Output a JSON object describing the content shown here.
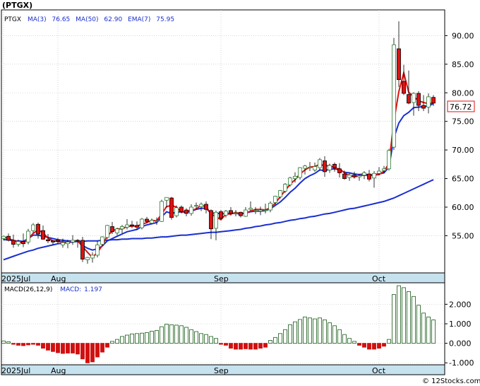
{
  "header": {
    "ticker": "(PTGX)",
    "legend_symbol": "PTGX",
    "ma3_label": "MA(3)",
    "ma3_value": "76.65",
    "ma50_label": "MA(50)",
    "ma50_value": "62.90",
    "ema7_label": "EMA(7)",
    "ema7_value": "75.95"
  },
  "price_box": "76.72",
  "macd_header": {
    "label": "MACD(26,12,9)",
    "value_label": "MACD:",
    "value": "1.197"
  },
  "watermark": "© 12Stocks.com",
  "colors": {
    "up": "#2e7d32",
    "down": "#e01010",
    "ma": "#1a2fd0",
    "ema": "#e01010",
    "axis_band": "#c6e2ef",
    "macd_up": "#2e6b2e",
    "macd_down": "#d01010"
  },
  "chart_data": [
    {
      "type": "candlestick",
      "title": "PTGX",
      "x_labels": [
        "2025Jul",
        "Aug",
        "Sep",
        "Oct"
      ],
      "x_label_index": [
        0,
        11,
        44,
        76
      ],
      "ylim": [
        48.5,
        94.5
      ],
      "yticks": [
        55.0,
        60.0,
        65.0,
        70.0,
        75.0,
        80.0,
        85.0,
        90.0
      ],
      "ytick_labels": [
        "55.00",
        "60.00",
        "65.00",
        "70.00",
        "75.00",
        "80.00",
        "85.00",
        "90.00"
      ],
      "grid": true,
      "ohlc": [
        [
          54.5,
          55.0,
          54.2,
          54.9
        ],
        [
          54.9,
          55.4,
          54.0,
          54.2
        ],
        [
          54.2,
          55.2,
          52.9,
          53.5
        ],
        [
          53.5,
          54.3,
          53.1,
          54.0
        ],
        [
          54.0,
          55.4,
          53.0,
          53.6
        ],
        [
          53.9,
          56.2,
          53.5,
          55.8
        ],
        [
          55.9,
          57.2,
          55.5,
          56.9
        ],
        [
          57.0,
          57.3,
          54.5,
          55.3
        ],
        [
          55.9,
          56.8,
          54.3,
          54.4
        ],
        [
          54.3,
          55.3,
          53.7,
          54.1
        ],
        [
          54.1,
          54.2,
          53.4,
          53.9
        ],
        [
          54.2,
          54.6,
          53.6,
          54.0
        ],
        [
          53.4,
          54.5,
          52.9,
          53.8
        ],
        [
          53.6,
          54.3,
          52.8,
          53.9
        ],
        [
          53.9,
          55.1,
          53.4,
          54.2
        ],
        [
          54.2,
          54.4,
          52.9,
          54.1
        ],
        [
          54.2,
          54.8,
          50.4,
          50.9
        ],
        [
          50.8,
          51.3,
          50.1,
          51.2
        ],
        [
          51.1,
          52.1,
          50.3,
          51.6
        ],
        [
          51.6,
          54.1,
          51.2,
          53.4
        ],
        [
          53.5,
          54.9,
          53.2,
          54.8
        ],
        [
          54.7,
          56.9,
          54.4,
          56.8
        ],
        [
          56.6,
          57.4,
          55.3,
          55.7
        ],
        [
          55.5,
          56.4,
          55.1,
          56.2
        ],
        [
          56.2,
          56.9,
          55.4,
          56.6
        ],
        [
          56.5,
          57.9,
          56.1,
          56.9
        ],
        [
          56.9,
          57.6,
          56.3,
          56.7
        ],
        [
          56.8,
          57.5,
          56.0,
          56.5
        ],
        [
          56.4,
          58.1,
          56.1,
          57.9
        ],
        [
          57.9,
          58.3,
          57.2,
          57.5
        ],
        [
          57.2,
          58.0,
          57.0,
          57.7
        ],
        [
          57.6,
          58.2,
          56.9,
          57.6
        ],
        [
          57.5,
          61.3,
          57.4,
          61.0
        ],
        [
          61.2,
          61.5,
          59.9,
          61.7
        ],
        [
          61.6,
          61.8,
          57.8,
          58.2
        ],
        [
          58.5,
          60.3,
          58.2,
          59.9
        ],
        [
          60.0,
          60.3,
          58.9,
          59.2
        ],
        [
          59.5,
          59.8,
          58.4,
          58.9
        ],
        [
          58.9,
          60.5,
          58.5,
          60.0
        ],
        [
          60.3,
          60.8,
          59.6,
          60.3
        ],
        [
          60.1,
          60.8,
          59.3,
          60.5
        ],
        [
          60.5,
          61.0,
          58.9,
          59.6
        ],
        [
          59.4,
          59.6,
          54.4,
          56.2
        ],
        [
          56.3,
          59.4,
          54.2,
          59.1
        ],
        [
          59.2,
          59.5,
          57.8,
          58.1
        ],
        [
          58.6,
          59.5,
          58.2,
          59.3
        ],
        [
          59.4,
          60.0,
          58.5,
          58.9
        ],
        [
          59.0,
          59.5,
          58.4,
          59.0
        ],
        [
          59.1,
          59.2,
          58.2,
          58.5
        ],
        [
          58.4,
          60.0,
          58.3,
          59.5
        ],
        [
          59.6,
          61.0,
          59.3,
          59.8
        ],
        [
          59.3,
          60.0,
          58.8,
          59.4
        ],
        [
          59.3,
          60.1,
          58.6,
          59.5
        ],
        [
          59.4,
          60.6,
          58.9,
          59.5
        ],
        [
          59.5,
          61.0,
          59.1,
          60.7
        ],
        [
          60.8,
          62.0,
          60.4,
          61.9
        ],
        [
          61.8,
          63.0,
          61.5,
          62.9
        ],
        [
          62.8,
          64.2,
          62.5,
          64.0
        ],
        [
          63.9,
          65.3,
          63.6,
          65.1
        ],
        [
          65.0,
          66.1,
          64.3,
          65.4
        ],
        [
          65.2,
          67.0,
          64.8,
          66.9
        ],
        [
          66.8,
          67.4,
          65.7,
          67.2
        ],
        [
          67.0,
          67.9,
          66.3,
          67.0
        ],
        [
          66.5,
          67.8,
          66.2,
          67.1
        ],
        [
          66.9,
          68.6,
          66.4,
          68.3
        ],
        [
          68.1,
          68.9,
          65.3,
          66.2
        ],
        [
          66.5,
          67.6,
          66.0,
          67.3
        ],
        [
          67.5,
          67.8,
          66.2,
          66.9
        ],
        [
          66.7,
          67.7,
          65.2,
          66.0
        ],
        [
          65.8,
          66.4,
          64.8,
          65.0
        ],
        [
          65.2,
          66.0,
          64.6,
          65.6
        ],
        [
          65.6,
          66.2,
          65.0,
          65.3
        ],
        [
          65.3,
          65.8,
          64.6,
          65.5
        ],
        [
          65.6,
          66.3,
          64.9,
          66.0
        ],
        [
          65.8,
          66.5,
          64.5,
          64.9
        ],
        [
          65.1,
          66.3,
          63.4,
          65.9
        ],
        [
          65.9,
          67.0,
          65.6,
          66.3
        ],
        [
          66.4,
          67.2,
          65.9,
          66.7
        ],
        [
          66.7,
          70.2,
          66.4,
          69.9
        ],
        [
          70.5,
          89.6,
          70.0,
          88.4
        ],
        [
          87.7,
          92.5,
          81.0,
          82.3
        ],
        [
          82.0,
          84.9,
          79.6,
          79.9
        ],
        [
          79.7,
          83.9,
          78.0,
          78.2
        ],
        [
          78.3,
          80.1,
          76.0,
          79.9
        ],
        [
          79.9,
          80.3,
          76.8,
          77.8
        ],
        [
          77.8,
          79.6,
          76.8,
          77.3
        ],
        [
          77.5,
          79.9,
          76.4,
          79.3
        ],
        [
          79.2,
          79.6,
          77.7,
          78.2
        ]
      ],
      "series": [
        {
          "name": "MA(3)",
          "color": "#e01010",
          "x_start": 0,
          "values": [
            54.8,
            54.5,
            54.2,
            53.9,
            53.7,
            54.5,
            55.4,
            56.0,
            55.5,
            54.6,
            54.1,
            54.0,
            53.9,
            53.9,
            54.0,
            54.1,
            53.1,
            52.1,
            51.2,
            52.1,
            53.3,
            55.0,
            55.8,
            56.2,
            56.2,
            56.6,
            56.7,
            56.7,
            57.0,
            57.3,
            57.7,
            57.6,
            58.8,
            60.1,
            60.3,
            60.0,
            59.1,
            59.3,
            59.4,
            59.7,
            60.3,
            60.1,
            58.8,
            58.3,
            57.8,
            58.8,
            58.8,
            59.1,
            58.8,
            59.0,
            59.3,
            59.6,
            59.6,
            59.5,
            59.9,
            60.7,
            61.8,
            62.9,
            64.0,
            64.8,
            65.8,
            66.5,
            67.0,
            67.1,
            67.5,
            67.2,
            67.3,
            66.8,
            66.7,
            66.0,
            65.5,
            65.3,
            65.5,
            65.6,
            65.5,
            65.6,
            65.7,
            66.3,
            67.6,
            75.0,
            80.2,
            83.5,
            80.1,
            79.3,
            78.6,
            78.3,
            78.1,
            78.2
          ]
        },
        {
          "name": "EMA(7)",
          "color": "#1a2fd0",
          "x_start": 0,
          "values": [
            54.3,
            54.3,
            54.1,
            54.1,
            54.0,
            54.5,
            55.1,
            55.1,
            54.9,
            54.7,
            54.5,
            54.3,
            54.2,
            54.1,
            54.1,
            54.1,
            53.3,
            52.8,
            52.5,
            52.7,
            53.2,
            54.1,
            54.5,
            54.9,
            55.3,
            55.7,
            55.9,
            56.1,
            56.6,
            56.9,
            57.1,
            57.3,
            58.3,
            59.2,
            58.9,
            59.1,
            59.2,
            59.1,
            59.3,
            59.6,
            59.8,
            59.8,
            58.9,
            59.0,
            58.8,
            58.9,
            58.9,
            58.9,
            58.8,
            59.0,
            59.2,
            59.3,
            59.3,
            59.4,
            59.7,
            60.3,
            60.9,
            61.7,
            62.6,
            63.3,
            64.2,
            65.0,
            65.5,
            65.9,
            66.5,
            66.4,
            66.6,
            66.7,
            66.5,
            66.1,
            66.0,
            65.8,
            65.7,
            65.8,
            65.6,
            65.7,
            65.8,
            66.0,
            67.0,
            72.1,
            74.7,
            76.0,
            76.6,
            77.4,
            77.5,
            77.6,
            77.7,
            78.1
          ]
        },
        {
          "name": "MA(50)",
          "color": "#1a2fd0",
          "x_start": 0,
          "values": [
            50.8,
            51.1,
            51.4,
            51.7,
            52.0,
            52.3,
            52.5,
            52.8,
            53.0,
            53.2,
            53.4,
            53.6,
            53.7,
            53.8,
            53.9,
            54.0,
            54.0,
            54.1,
            54.1,
            54.1,
            54.2,
            54.2,
            54.3,
            54.3,
            54.4,
            54.4,
            54.5,
            54.5,
            54.5,
            54.6,
            54.6,
            54.7,
            54.8,
            54.8,
            54.9,
            55.0,
            55.1,
            55.1,
            55.2,
            55.3,
            55.4,
            55.5,
            55.6,
            55.6,
            55.7,
            55.8,
            55.9,
            56.0,
            56.1,
            56.3,
            56.4,
            56.6,
            56.7,
            56.9,
            57.0,
            57.2,
            57.3,
            57.5,
            57.7,
            57.8,
            58.0,
            58.1,
            58.3,
            58.4,
            58.6,
            58.8,
            58.9,
            59.1,
            59.3,
            59.5,
            59.7,
            59.8,
            60.0,
            60.2,
            60.4,
            60.6,
            60.8,
            61.0,
            61.3,
            61.6,
            62.0,
            62.4,
            62.8,
            63.2,
            63.6,
            64.0,
            64.4,
            64.8
          ]
        }
      ]
    },
    {
      "type": "bar",
      "title": "MACD(26,12,9)",
      "ylim": [
        -1.1,
        3.1
      ],
      "yticks": [
        -1.0,
        0.0,
        1.0,
        2.0
      ],
      "ytick_labels": [
        "-1.000",
        "0.000",
        "1.000",
        "2.000"
      ],
      "values": [
        0.12,
        0.08,
        -0.05,
        -0.1,
        -0.12,
        -0.08,
        -0.05,
        -0.1,
        -0.25,
        -0.35,
        -0.42,
        -0.48,
        -0.52,
        -0.5,
        -0.5,
        -0.55,
        -0.8,
        -1.0,
        -0.95,
        -0.7,
        -0.45,
        -0.2,
        0.1,
        0.2,
        0.35,
        0.42,
        0.48,
        0.5,
        0.52,
        0.55,
        0.62,
        0.66,
        0.85,
        0.98,
        0.95,
        0.93,
        0.9,
        0.82,
        0.7,
        0.6,
        0.5,
        0.45,
        0.35,
        0.25,
        -0.05,
        -0.1,
        -0.25,
        -0.3,
        -0.3,
        -0.28,
        -0.3,
        -0.3,
        -0.25,
        -0.2,
        0.15,
        0.3,
        0.5,
        0.7,
        0.95,
        1.1,
        1.22,
        1.35,
        1.3,
        1.25,
        1.3,
        1.2,
        1.05,
        0.9,
        0.7,
        0.45,
        0.25,
        0.1,
        -0.1,
        -0.2,
        -0.3,
        -0.3,
        -0.25,
        -0.15,
        0.2,
        2.5,
        2.95,
        2.85,
        2.65,
        2.4,
        1.95,
        1.55,
        1.35,
        1.2
      ]
    }
  ]
}
